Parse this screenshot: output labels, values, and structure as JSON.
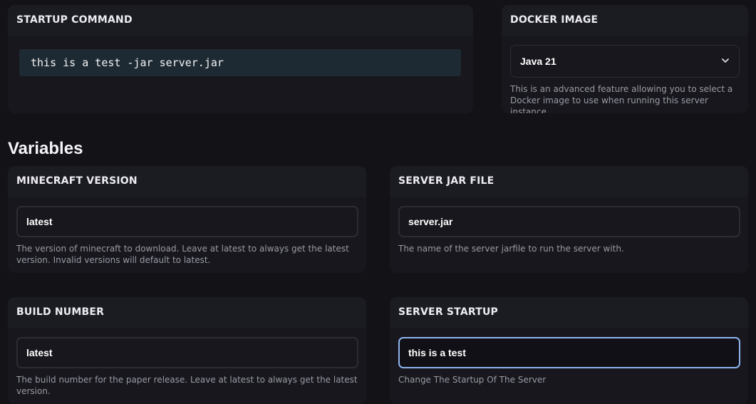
{
  "startup": {
    "title": "STARTUP COMMAND",
    "command": "this is a test -jar server.jar"
  },
  "docker": {
    "title": "DOCKER IMAGE",
    "selected": "Java 21",
    "help": "This is an advanced feature allowing you to select a Docker image to use when running this server instance."
  },
  "variables": {
    "heading": "Variables",
    "items": [
      {
        "title": "MINECRAFT VERSION",
        "value": "latest",
        "help": "The version of minecraft to download. Leave at latest to always get the latest version. Invalid versions will default to latest."
      },
      {
        "title": "SERVER JAR FILE",
        "value": "server.jar",
        "help": "The name of the server jarfile to run the server with."
      },
      {
        "title": "BUILD NUMBER",
        "value": "latest",
        "help": "The build number for the paper release. Leave at latest to always get the latest version."
      },
      {
        "title": "SERVER STARTUP",
        "value": "this is a test",
        "help": "Change The Startup Of The Server"
      }
    ]
  },
  "icons": {
    "select_chevron": "chevron-down-icon"
  },
  "colors": {
    "page_bg": "#121217",
    "card_bg": "#1b1b22",
    "command_bg": "#1e2a33",
    "focus_border": "#8fb5ee"
  }
}
